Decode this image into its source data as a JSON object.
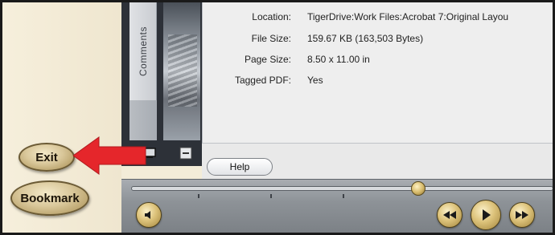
{
  "nav": {
    "exit_label": "Exit",
    "bookmark_label": "Bookmark"
  },
  "sidebar": {
    "comments_tab_label": "Comments"
  },
  "document_properties": {
    "rows": [
      {
        "label": "Location:",
        "value": "TigerDrive:Work Files:Acrobat 7:Original Layou"
      },
      {
        "label": "File Size:",
        "value": "159.67 KB (163,503 Bytes)"
      },
      {
        "label": "Page Size:",
        "value": "8.50 x 11.00 in"
      },
      {
        "label": "Tagged PDF:",
        "value": "Yes"
      }
    ]
  },
  "help": {
    "button_label": "Help"
  },
  "player": {
    "progress_fraction": 0.68
  },
  "icons": {
    "arrow": "red-arrow-icon",
    "volume": "speaker-icon",
    "rewind": "rewind-icon",
    "play": "play-icon",
    "forward": "fast-forward-icon"
  },
  "colors": {
    "arrow": "#e5262b",
    "nav_background": "#f3ecd8",
    "button_gold": "#d9c79a"
  }
}
